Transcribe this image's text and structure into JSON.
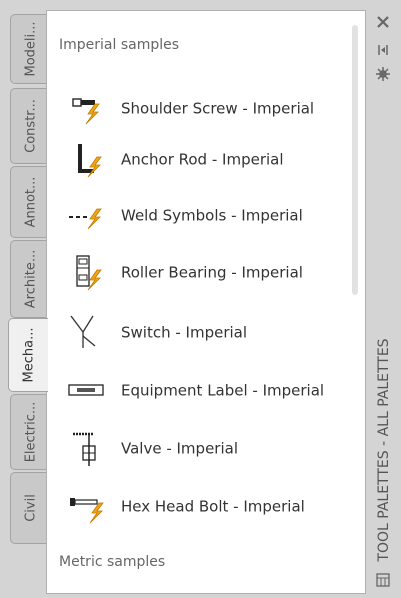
{
  "tabs": [
    {
      "label": "Modeli..."
    },
    {
      "label": "Constr..."
    },
    {
      "label": "Annot..."
    },
    {
      "label": "Archite..."
    },
    {
      "label": "Mecha..."
    },
    {
      "label": "Electric..."
    },
    {
      "label": "Civil"
    }
  ],
  "active_tab": "Mecha...",
  "panel": {
    "section_top": "Imperial samples",
    "section_bottom": "Metric samples",
    "items": [
      {
        "label": "Shoulder Screw - Imperial",
        "icon": "shoulder-screw-icon"
      },
      {
        "label": "Anchor Rod - Imperial",
        "icon": "anchor-rod-icon"
      },
      {
        "label": "Weld Symbols - Imperial",
        "icon": "weld-symbols-icon"
      },
      {
        "label": "Roller Bearing - Imperial",
        "icon": "roller-bearing-icon"
      },
      {
        "label": "Switch - Imperial",
        "icon": "switch-icon"
      },
      {
        "label": "Equipment Label - Imperial",
        "icon": "equipment-label-icon"
      },
      {
        "label": "Valve - Imperial",
        "icon": "valve-icon"
      },
      {
        "label": "Hex Head Bolt - Imperial",
        "icon": "hex-head-bolt-icon"
      }
    ]
  },
  "titlebar": {
    "title": "TOOL PALETTES - ALL PALETTES",
    "close_icon": "close-icon",
    "autohide_icon": "auto-hide-icon",
    "properties_icon": "properties-icon",
    "palette_icon": "palette-icon"
  },
  "colors": {
    "lightning": "#f2a516",
    "panel_bg": "#ffffff",
    "frame_bg": "#d4d4d4"
  }
}
